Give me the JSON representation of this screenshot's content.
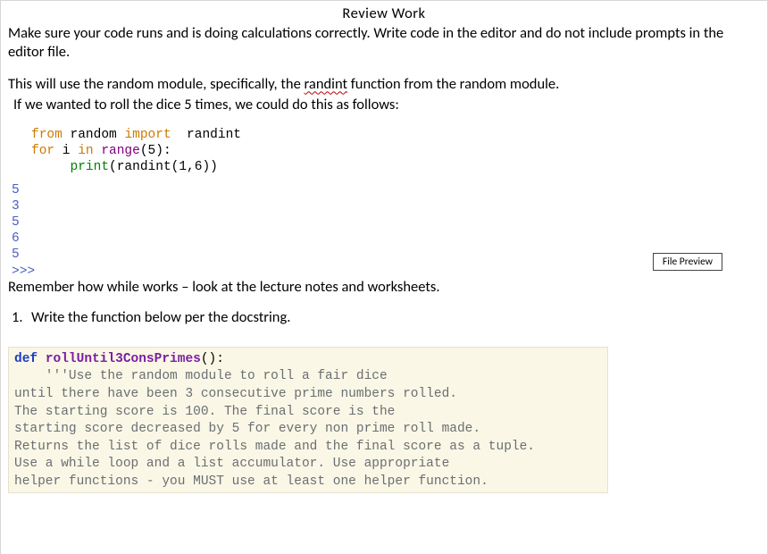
{
  "title": "Review  Work",
  "intro1": "Make sure your code runs and is doing calculations correctly.  Write code in the editor and do not include prompts in the editor file.",
  "intro2_pre": "This  will use the random module, specifically, the ",
  "intro2_squiggle": "randint",
  "intro2_post": " function from the random module.",
  "intro3": "If we wanted to roll the dice 5 times, we could do this as follows:",
  "code1": {
    "l1": {
      "t1": "from",
      "t2": " random ",
      "t3": "import",
      "t4": "  randint"
    },
    "l2": {
      "t1": "for",
      "t2": " i ",
      "t3": "in",
      "t4": " ",
      "t5": "range",
      "t6": "(5):"
    },
    "l3": {
      "t1": "     ",
      "t2": "print",
      "t3": "(randint(1,6))"
    }
  },
  "output_lines": [
    "5",
    "3",
    "5",
    "6",
    "5",
    ">>>"
  ],
  "remember": "Remember how while works – look at the lecture notes and worksheets.",
  "question_num": "1.",
  "question_text": "Write the function below per the docstring.",
  "file_preview": "File Preview",
  "codeblock": {
    "def_kw": "def",
    "def_sp": " ",
    "def_name": "rollUntil3ConsPrimes",
    "def_par": "():",
    "doc": [
      "    '''Use the random module to roll a fair dice",
      "until there have been 3 consecutive prime numbers rolled.",
      "The starting score is 100. The final score is the",
      "starting score decreased by 5 for every non prime roll made.",
      "Returns the list of dice rolls made and the final score as a tuple.",
      "Use a while loop and a list accumulator. Use appropriate",
      "helper functions - you MUST use at least one helper function."
    ]
  }
}
